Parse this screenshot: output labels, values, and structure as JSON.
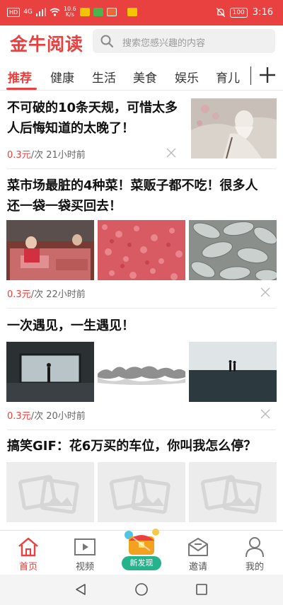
{
  "status_bar": {
    "hd": "HD",
    "signal": "4G",
    "speed": "10.6\nK/s",
    "battery": "100",
    "time": "3:16"
  },
  "header": {
    "logo": "金牛阅读",
    "search_placeholder": "搜索您感兴趣的内容"
  },
  "tabs": [
    {
      "label": "推荐",
      "active": true
    },
    {
      "label": "健康"
    },
    {
      "label": "生活"
    },
    {
      "label": "美食"
    },
    {
      "label": "娱乐"
    },
    {
      "label": "育儿"
    }
  ],
  "articles": [
    {
      "title_line1": "不可破的10条天规，可惜太多",
      "title_line2": "人后悔知道的太晚了！",
      "price": "0.3元",
      "meta": "/次 21小时前"
    },
    {
      "title_line1": "菜市场最脏的4种菜！菜贩子都不吃！很多人",
      "title_line2": "还一袋一袋买回去！",
      "price": "0.3元",
      "meta": "/次 22小时前"
    },
    {
      "title_line1": "一次遇见，一生遇见！",
      "price": "0.3元",
      "meta": "/次 20小时前"
    },
    {
      "title_line1": "搞笑GIF：花6万买的车位，你叫我怎么停？"
    }
  ],
  "bottom_nav": [
    {
      "label": "首页",
      "icon": "home-icon",
      "active": true
    },
    {
      "label": "视频",
      "icon": "video-icon"
    },
    {
      "label": "新发现",
      "icon": "discover-chest-icon"
    },
    {
      "label": "邀请",
      "icon": "invite-envelope-icon"
    },
    {
      "label": "我的",
      "icon": "profile-icon"
    }
  ],
  "colors": {
    "accent": "#e8413f",
    "discover": "#25b38c"
  }
}
